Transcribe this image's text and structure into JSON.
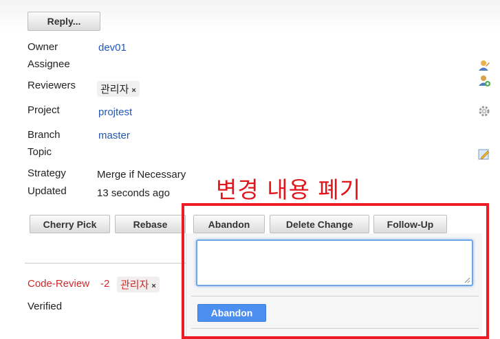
{
  "toolbar": {
    "reply_label": "Reply..."
  },
  "details": {
    "owner_label": "Owner",
    "owner_value": "dev01",
    "assignee_label": "Assignee",
    "reviewers_label": "Reviewers",
    "reviewer_name": "관리자",
    "remove_symbol": "×",
    "project_label": "Project",
    "project_value": "projtest",
    "branch_label": "Branch",
    "branch_value": "master",
    "topic_label": "Topic",
    "strategy_label": "Strategy",
    "strategy_value": "Merge if Necessary",
    "updated_label": "Updated",
    "updated_value": "13 seconds ago"
  },
  "actions": {
    "cherry_pick": "Cherry Pick",
    "rebase": "Rebase",
    "abandon": "Abandon",
    "delete_change": "Delete Change",
    "follow_up": "Follow-Up"
  },
  "labels": {
    "code_review_label": "Code-Review",
    "code_review_score": "-2",
    "code_review_user": "관리자",
    "remove_symbol": "×",
    "verified_label": "Verified"
  },
  "annotation": {
    "text": "변경 내용 폐기",
    "color": "#ed1c24"
  },
  "abandon_panel": {
    "message_value": "",
    "submit_label": "Abandon"
  },
  "icons": {
    "assignee_edit": "person-edit-icon",
    "reviewer_add": "person-add-icon",
    "project_settings": "gear-icon",
    "topic_edit": "pencil-edit-icon"
  }
}
